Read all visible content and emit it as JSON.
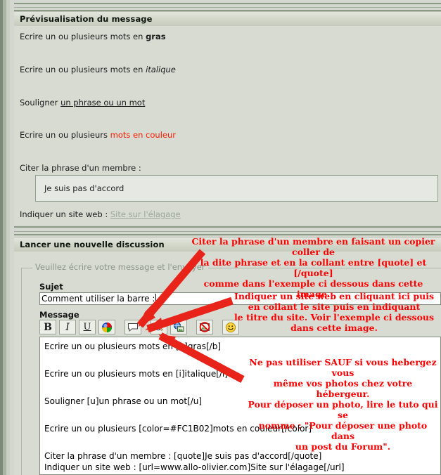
{
  "preview": {
    "title": "Prévisualisation du message",
    "lines": [
      {
        "pre": "Ecrire un ou plusieurs mots en ",
        "styled": "gras",
        "style": "bold"
      },
      {
        "pre": "Ecrire un ou plusieurs mots en ",
        "styled": "italique",
        "style": "italic"
      },
      {
        "pre": "Souligner ",
        "styled": "un phrase ou un mot",
        "style": "underline"
      },
      {
        "pre": "Ecrire un ou plusieurs ",
        "styled": "mots en couleur",
        "style": "color"
      }
    ],
    "quote_label": "Citer la phrase d'un membre :",
    "quote_text": "Je suis pas d'accord",
    "site_label": "Indiquer un site web : ",
    "site_link": "Site sur l'élagage",
    "color_hex": "#FC1B02"
  },
  "form": {
    "title": "Lancer une nouvelle discussion",
    "legend": "Veuillez écrire votre message et l'envoyer",
    "subject_label": "Sujet",
    "subject_value": "Comment utiliser la barre :",
    "message_label": "Message",
    "toolbar": [
      {
        "name": "bold-button",
        "glyph": "B",
        "kind": "bold"
      },
      {
        "name": "italic-button",
        "glyph": "I",
        "kind": "italic"
      },
      {
        "name": "underline-button",
        "glyph": "U",
        "kind": "underline"
      },
      {
        "name": "color-wheel-button",
        "glyph": "",
        "kind": "colorwheel"
      },
      {
        "name": "quote-button",
        "glyph": "",
        "kind": "quote"
      },
      {
        "name": "insert-url-button",
        "glyph": "",
        "kind": "url"
      },
      {
        "name": "insert-image-button",
        "glyph": "",
        "kind": "image"
      },
      {
        "name": "no-image-button",
        "glyph": "",
        "kind": "noimage"
      },
      {
        "name": "smiley-button",
        "glyph": "",
        "kind": "smiley"
      }
    ],
    "message_lines": [
      "Ecrire un ou plusieurs mots en [b]gras[/b]",
      "Ecrire un ou plusieurs mots en [i]italique[/i]",
      "Souligner [u]un phrase ou un mot[/u]",
      "Ecrire un ou plusieurs [color=#FC1B02]mots en couleur[/color]",
      "Citer la phrase d'un membre : [quote]Je suis pas d'accord[/quote]",
      "Indiquer un site web : [url=www.allo-olivier.com]Site sur l'élagage[/url]"
    ]
  },
  "annotations": {
    "quote_note": "Citer la phrase d'un membre en faisant un copier coller de\nla dite phrase et en la collant entre [quote] et [/quote]\ncomme dans l'exemple ci dessous dans cette image.",
    "url_note": "Indiquer un site web en cliquant ici puis\nen collant le site puis en indiquant\nle titre du site. Voir l'exemple ci dessous\ndans cette image.",
    "image_note": "Ne pas utiliser SAUF si vous hebergez vous\nmême vos photos chez votre hébergeur.\nPour déposer un photo, lire le tuto qui se\nnomme : \"Pour déposer une photo dans\nun post du Forum\".",
    "color": "#FF0000"
  }
}
